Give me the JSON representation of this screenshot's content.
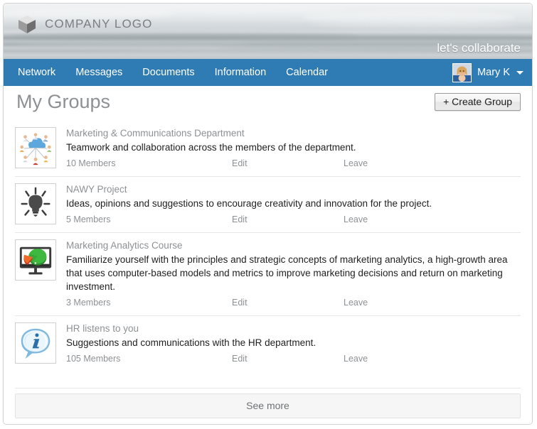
{
  "brand": {
    "logo_icon": "cube-icon",
    "logo_text": "COMPANY LOGO",
    "tagline": "let's collaborate",
    "nav_color": "#2f7cb5",
    "title_color": "#8e9194"
  },
  "nav": {
    "items": [
      {
        "label": "Network"
      },
      {
        "label": "Messages"
      },
      {
        "label": "Documents"
      },
      {
        "label": "Information"
      },
      {
        "label": "Calendar"
      }
    ],
    "user": {
      "name": "Mary K",
      "avatar_icon": "user-photo-avatar",
      "caret_icon": "chevron-down-icon"
    }
  },
  "page": {
    "title": "My Groups",
    "create_button": "+ Create Group",
    "see_more": "See more"
  },
  "groups": [
    {
      "icon": "network-people-cloud-icon",
      "name": "Marketing & Communications Department",
      "description": "Teamwork and collaboration across the members of the department.",
      "members": "10 Members",
      "edit": "Edit",
      "leave": "Leave"
    },
    {
      "icon": "lightbulb-idea-icon",
      "name": "NAWY Project",
      "description": "Ideas, opinions and suggestions to encourage creativity and innovation for the project.",
      "members": "5 Members",
      "edit": "Edit",
      "leave": "Leave"
    },
    {
      "icon": "monitor-pie-chart-icon",
      "name": "Marketing Analytics Course",
      "description": "Familiarize yourself with the principles and strategic concepts of marketing analytics, a high-growth area that uses computer-based models and metrics to improve marketing decisions and return on marketing investment.",
      "members": "3 Members",
      "edit": "Edit",
      "leave": "Leave"
    },
    {
      "icon": "info-speech-bubble-icon",
      "name": "HR listens to you",
      "description": "Suggestions and communications with the HR department.",
      "members": "105 Members",
      "edit": "Edit",
      "leave": "Leave"
    }
  ]
}
